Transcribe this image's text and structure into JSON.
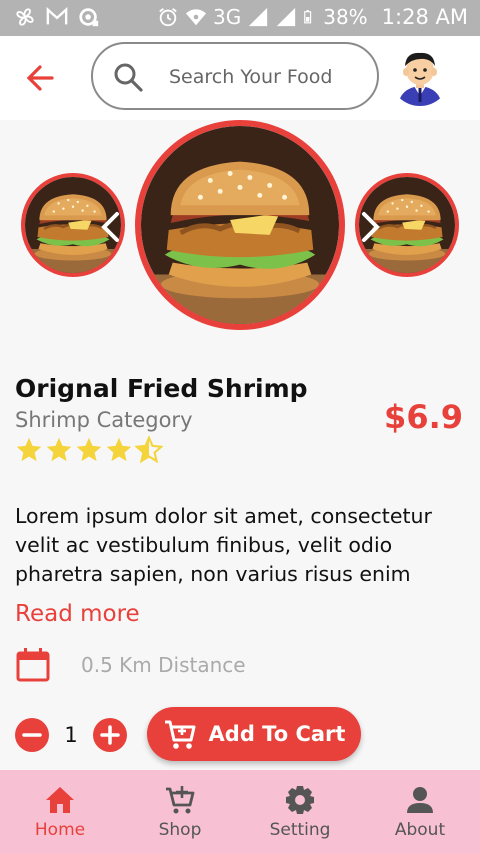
{
  "status_bar": {
    "network": "3G",
    "battery": "38%",
    "time": "1:28 AM"
  },
  "header": {
    "search_placeholder": "Search Your Food"
  },
  "product": {
    "name": "Orignal Fried Shrimp",
    "category": "Shrimp Category",
    "price": "$6.9",
    "rating": 4.5,
    "rating_max": 5,
    "description": "Lorem ipsum dolor sit amet, consectetur velit ac vestibulum finibus, velit odio pharetra sapien, non varius risus enim",
    "read_more": "Read more",
    "distance": "0.5 Km Distance",
    "quantity": "1",
    "add_to_cart": "Add To Cart"
  },
  "bottom_nav": {
    "items": [
      {
        "label": "Home"
      },
      {
        "label": "Shop"
      },
      {
        "label": "Setting"
      },
      {
        "label": "About"
      }
    ]
  },
  "colors": {
    "accent": "#e8403a",
    "nav_background": "#f8c0d3",
    "star": "#f5d33a"
  }
}
